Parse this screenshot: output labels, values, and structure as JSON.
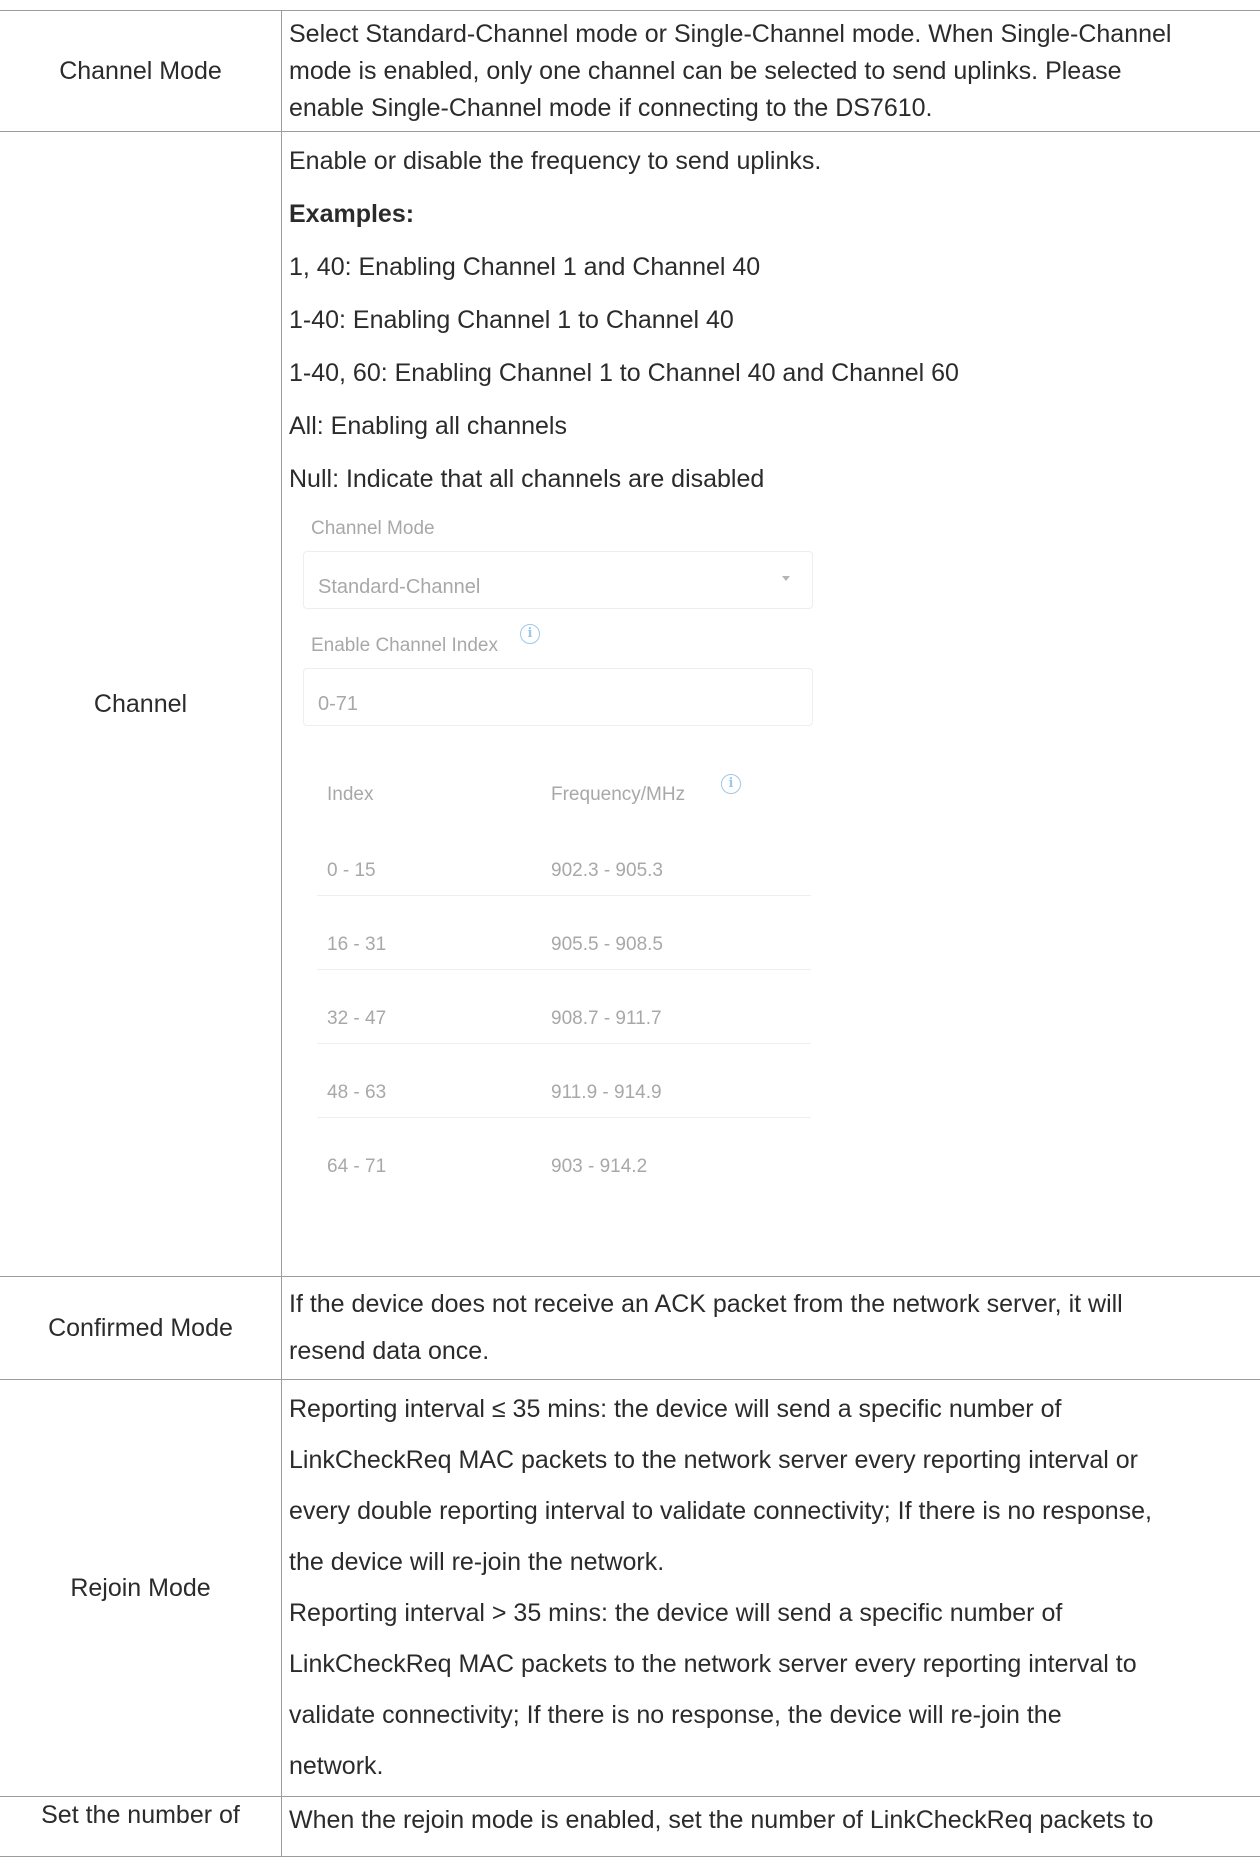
{
  "rows": {
    "channel_mode": {
      "label": "Channel Mode",
      "lines": [
        "Select Standard-Channel mode or Single-Channel mode. When Single-Channel",
        "mode is enabled, only one channel can be selected to send uplinks. Please",
        "enable Single-Channel mode if connecting to the DS7610."
      ]
    },
    "channel": {
      "label": "Channel",
      "intro": "Enable or disable the frequency to send uplinks.",
      "examples_heading": "Examples:",
      "examples": [
        "1, 40: Enabling Channel 1 and Channel 40",
        "1-40: Enabling Channel 1 to Channel 40",
        "1-40, 60: Enabling Channel 1 to Channel 40 and Channel 60",
        "All: Enabling all channels",
        "Null: Indicate that all channels are disabled"
      ],
      "panel": {
        "mode_label": "Channel Mode",
        "mode_value": "Standard-Channel",
        "index_label": "Enable Channel Index",
        "index_value": "0-71",
        "table_headers": [
          "Index",
          "Frequency/MHz"
        ],
        "table_rows": [
          [
            "0 - 15",
            "902.3 - 905.3"
          ],
          [
            "16 - 31",
            "905.5 - 908.5"
          ],
          [
            "32 - 47",
            "908.7 - 911.7"
          ],
          [
            "48 - 63",
            "911.9 - 914.9"
          ],
          [
            "64 - 71",
            "903 - 914.2"
          ]
        ],
        "info_glyph": "i"
      }
    },
    "confirmed_mode": {
      "label": "Confirmed Mode",
      "lines": [
        "If the device does not receive an ACK packet from the network server, it will",
        "resend data once."
      ]
    },
    "rejoin_mode": {
      "label": "Rejoin Mode",
      "lines": [
        "Reporting interval ≤ 35 mins: the device will send a specific number of",
        "LinkCheckReq MAC packets to the network server every reporting interval or",
        "every double reporting interval to validate connectivity; If there is no response,",
        "the device will re-join the network.",
        "Reporting interval > 35 mins: the device will send a specific number of",
        "LinkCheckReq MAC packets to the network server every reporting interval to",
        "validate connectivity; If there is no response, the device will re-join the",
        "network."
      ]
    },
    "set_number": {
      "label": "Set the number of",
      "lines": [
        "When the rejoin mode is enabled, set the number of LinkCheckReq packets to"
      ]
    }
  }
}
